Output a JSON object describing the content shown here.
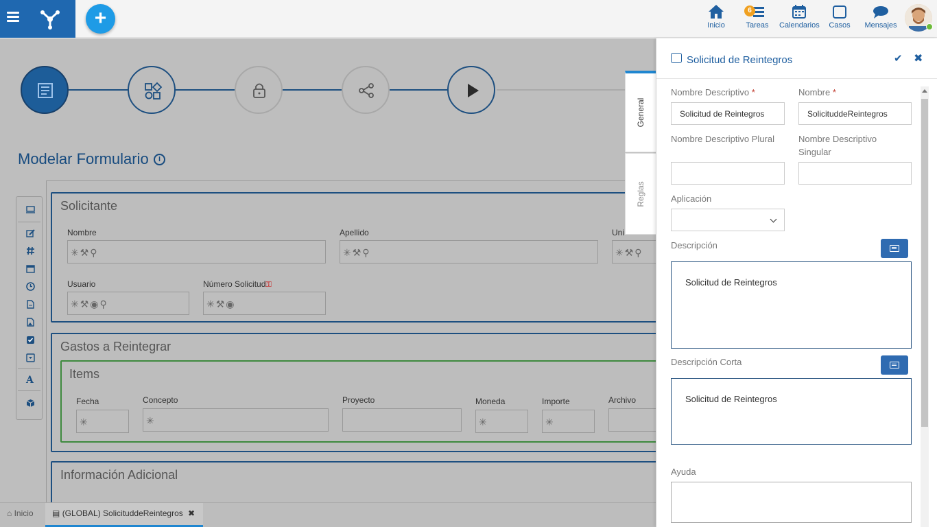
{
  "topbar": {
    "nav": [
      {
        "label": "Inicio",
        "icon": "home-icon"
      },
      {
        "label": "Tareas",
        "icon": "tasks-icon",
        "badge": "6"
      },
      {
        "label": "Calendarios",
        "icon": "calendar-icon"
      },
      {
        "label": "Casos",
        "icon": "cases-icon"
      },
      {
        "label": "Mensajes",
        "icon": "messages-icon"
      }
    ]
  },
  "stepper": {
    "icons": [
      "form-icon",
      "shapes-icon",
      "lock-icon",
      "share-icon",
      "play-icon"
    ]
  },
  "main": {
    "title": "Modelar Formulario",
    "info_icon": "info-icon",
    "toolbox_icons": [
      "monitor-icon",
      "edit-icon",
      "hash-icon",
      "calendar-icon",
      "clock-icon",
      "document-icon",
      "image-icon",
      "checkbox-icon",
      "dropdown-icon",
      "text-icon",
      "cube-icon"
    ],
    "sections": [
      {
        "title": "Solicitante",
        "fields": [
          {
            "label": "Nombre",
            "icons": "✳⚒⚲"
          },
          {
            "label": "Apellido",
            "icons": "✳⚒⚲"
          },
          {
            "label": "Uni",
            "icons": "✳⚒⚲"
          },
          {
            "label": "Usuario",
            "icons": "✳⚒◉⚲"
          },
          {
            "label": "Número Solicitud",
            "icons": "✳⚒◉"
          }
        ]
      },
      {
        "title": "Gastos a Reintegrar",
        "grid_title": "Items",
        "columns": [
          "Fecha",
          "Concepto",
          "Proyecto",
          "Moneda",
          "Importe",
          "Archivo"
        ]
      },
      {
        "title": "Información Adicional"
      }
    ]
  },
  "bottombar": {
    "tabs": [
      {
        "label": "Inicio"
      },
      {
        "label": "(GLOBAL) SolicituddeReintegros"
      }
    ]
  },
  "vtabs": {
    "general": "General",
    "rules": "Reglas"
  },
  "panel": {
    "title": "Solicitud de Reintegros",
    "fields": {
      "nombre_descriptivo": {
        "label": "Nombre Descriptivo",
        "required": "*",
        "value": "Solicitud de Reintegros"
      },
      "nombre": {
        "label": "Nombre",
        "required": "*",
        "value": "SolicituddeReintegros"
      },
      "nombre_descriptivo_plural": {
        "label": "Nombre Descriptivo Plural",
        "value": ""
      },
      "nombre_descriptivo_singular": {
        "label": "Nombre Descriptivo Singular",
        "value": ""
      },
      "aplicacion": {
        "label": "Aplicación",
        "value": ""
      },
      "descripcion": {
        "label": "Descripción",
        "value": "Solicitud de Reintegros"
      },
      "descripcion_corta": {
        "label": "Descripción Corta",
        "value": "Solicitud de Reintegros"
      },
      "ayuda": {
        "label": "Ayuda",
        "value": ""
      }
    }
  },
  "colors": {
    "brand": "#1f68b0",
    "accent": "#1e9be6",
    "panel_link": "#1f5fa0",
    "badge": "#f0a020",
    "status_online": "#6dbb3a"
  }
}
